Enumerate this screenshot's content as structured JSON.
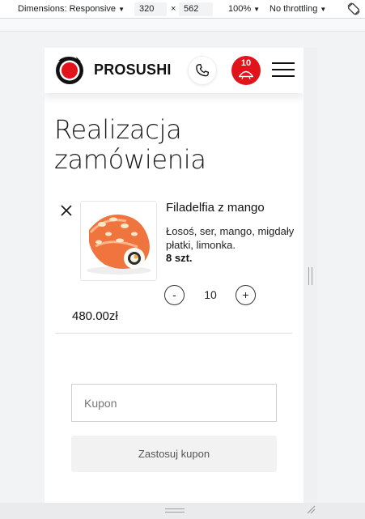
{
  "devtools": {
    "dimensions_label": "Dimensions: Responsive",
    "width": "320",
    "height": "562",
    "zoom": "100%",
    "throttling": "No throttling",
    "times": "×"
  },
  "header": {
    "brand": "PROSUSHI",
    "cart_count": "10",
    "accent_color": "#e3131b"
  },
  "page": {
    "title": "Realizacja zamówienia"
  },
  "cart_item": {
    "name": "Filadelfia z mango",
    "description": "Łosoś, ser, mango, migdały płatki, limonka.",
    "pieces": "8 szt.",
    "quantity": "10",
    "minus_label": "-",
    "plus_label": "+",
    "price": "480.00zł"
  },
  "coupon": {
    "placeholder": "Kupon",
    "apply_label": "Zastosuj kupon"
  }
}
